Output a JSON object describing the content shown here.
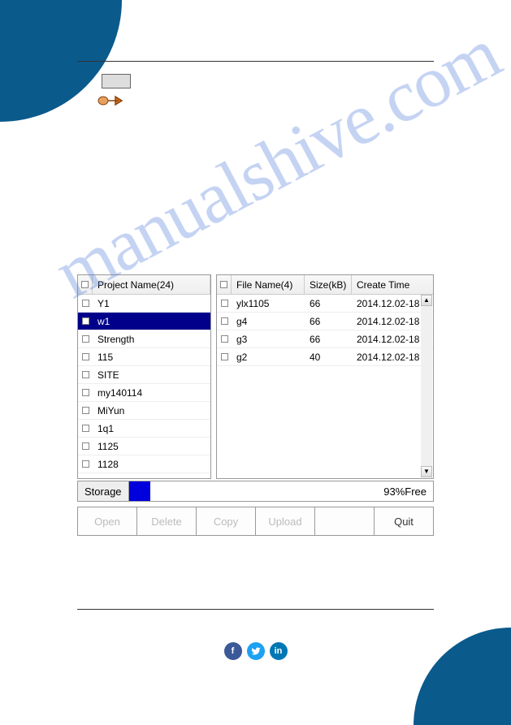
{
  "watermark": "manualshive.com",
  "panels": {
    "project_header": "Project Name(24)",
    "file_headers": {
      "name": "File Name(4)",
      "size": "Size(kB)",
      "time": "Create Time"
    },
    "projects": [
      {
        "name": "Y1",
        "selected": false
      },
      {
        "name": "w1",
        "selected": true
      },
      {
        "name": "Strength",
        "selected": false
      },
      {
        "name": "115",
        "selected": false
      },
      {
        "name": "SITE",
        "selected": false
      },
      {
        "name": "my140114",
        "selected": false
      },
      {
        "name": "MiYun",
        "selected": false
      },
      {
        "name": "1q1",
        "selected": false
      },
      {
        "name": "1125",
        "selected": false
      },
      {
        "name": "1128",
        "selected": false
      }
    ],
    "files": [
      {
        "name": "ylx1105",
        "size": "66",
        "time": "2014.12.02-18"
      },
      {
        "name": "g4",
        "size": "66",
        "time": "2014.12.02-18"
      },
      {
        "name": "g3",
        "size": "66",
        "time": "2014.12.02-18"
      },
      {
        "name": "g2",
        "size": "40",
        "time": "2014.12.02-18"
      }
    ]
  },
  "storage": {
    "label": "Storage",
    "free_text": "93%Free",
    "used_pct": 7
  },
  "buttons": {
    "open": "Open",
    "delete": "Delete",
    "copy": "Copy",
    "upload": "Upload",
    "blank": "",
    "quit": "Quit"
  },
  "social": {
    "fb": "f",
    "tw": "",
    "li": "in"
  }
}
